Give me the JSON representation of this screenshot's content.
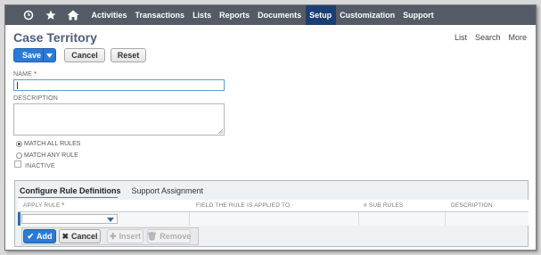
{
  "nav": {
    "icons": [
      "recent-icon",
      "star-icon",
      "home-icon"
    ],
    "items": [
      {
        "label": "Activities"
      },
      {
        "label": "Transactions"
      },
      {
        "label": "Lists"
      },
      {
        "label": "Reports"
      },
      {
        "label": "Documents"
      },
      {
        "label": "Setup",
        "active": true
      },
      {
        "label": "Customization"
      },
      {
        "label": "Support"
      }
    ],
    "bg_color": "#555b66",
    "active_color": "#1b3f73"
  },
  "page": {
    "title": "Case Territory",
    "links": {
      "list": "List",
      "search": "Search",
      "more": "More"
    }
  },
  "toolbar": {
    "save_label": "Save",
    "cancel_label": "Cancel",
    "reset_label": "Reset",
    "accent_color": "#2b7bd6"
  },
  "form": {
    "name_label": "NAME",
    "name_required": "*",
    "name_value": "",
    "description_label": "DESCRIPTION",
    "description_value": "",
    "match_all_label": "MATCH ALL RULES",
    "match_any_label": "MATCH ANY RULE",
    "selected_match": "MATCH ALL RULES",
    "inactive_label": "INACTIVE",
    "inactive_checked": false
  },
  "sublist": {
    "tabs": [
      {
        "label": "Configure Rule Definitions",
        "active": true
      },
      {
        "label": "Support Assignment",
        "active": false
      }
    ],
    "columns": [
      {
        "label": "APPLY RULE",
        "required": "*"
      },
      {
        "label": "FIELD THE RULE IS APPLIED TO"
      },
      {
        "label": "# SUB RULES"
      },
      {
        "label": "DESCRIPTION"
      }
    ],
    "row": {
      "apply_rule": ""
    },
    "buttons": {
      "add": "Add",
      "cancel": "Cancel",
      "insert": "Insert",
      "remove": "Remove"
    }
  }
}
